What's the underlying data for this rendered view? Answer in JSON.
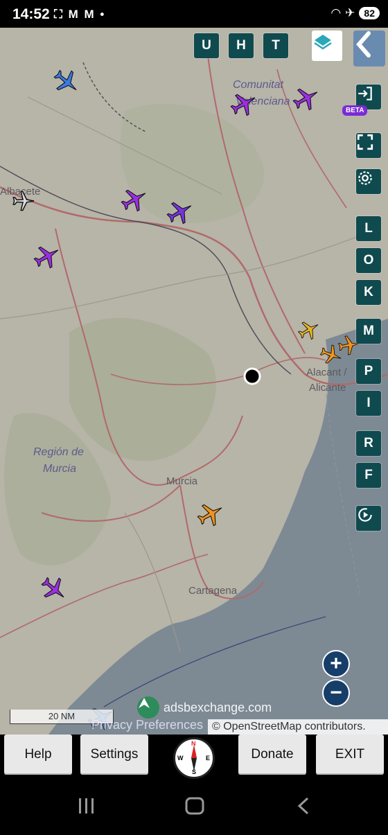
{
  "status_bar": {
    "time": "14:52",
    "notif_icons": "⛶ M M •",
    "battery": "82"
  },
  "map": {
    "labels": {
      "albacete": "Albacete",
      "comunitat1": "Comunitat",
      "comunitat2": "Valenciana",
      "alacant": "Alacant /",
      "alicante": "Alicante",
      "region1": "Región de",
      "region2": "Murcia",
      "murcia": "Murcia",
      "cartagena": "Cartagena"
    },
    "plane_colors": {
      "blue": "#3a7be0",
      "purple": "#9b2fe0",
      "orange": "#f0941e",
      "yellow": "#e8b420",
      "gray": "#333333"
    }
  },
  "top_buttons": [
    "U",
    "H",
    "T"
  ],
  "side_buttons": [
    "L",
    "O",
    "K",
    "M",
    "P",
    "I",
    "R",
    "F"
  ],
  "beta_label": "BETA",
  "zoom": {
    "plus": "+",
    "minus": "−"
  },
  "scale_label": "20 NM",
  "brand": "adsbexchange.com",
  "privacy": "Privacy Preferences",
  "attribution": "© OpenStreetMap contributors.",
  "toolbar": {
    "help": "Help",
    "settings": "Settings",
    "donate": "Donate",
    "exit": "EXIT"
  },
  "compass_letters": {
    "n": "N",
    "e": "E",
    "s": "S",
    "w": "W"
  }
}
